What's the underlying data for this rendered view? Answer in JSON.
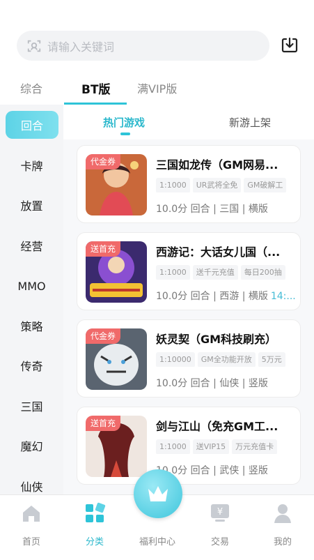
{
  "search": {
    "placeholder": "请输入关键词"
  },
  "main_tabs": [
    {
      "label": "综合"
    },
    {
      "label": "BT版"
    },
    {
      "label": "满VIP版"
    }
  ],
  "sidebar": {
    "items": [
      {
        "label": "回合"
      },
      {
        "label": "卡牌"
      },
      {
        "label": "放置"
      },
      {
        "label": "经营"
      },
      {
        "label": "MMO"
      },
      {
        "label": "策略"
      },
      {
        "label": "传奇"
      },
      {
        "label": "三国"
      },
      {
        "label": "魔幻"
      },
      {
        "label": "仙侠"
      }
    ]
  },
  "sub_tabs": [
    {
      "label": "热门游戏"
    },
    {
      "label": "新游上架"
    }
  ],
  "games": [
    {
      "badge": "代金券",
      "title": "三国如龙传（GM网易...",
      "tags": [
        "1:1000",
        "UR武将全免",
        "GM破解工"
      ],
      "meta": "10.0分 回合 | 三国 | 横版",
      "time": ""
    },
    {
      "badge": "送首充",
      "title": "西游记：大话女儿国（...",
      "tags": [
        "1:1000",
        "送千元充值",
        "每日200抽"
      ],
      "meta": "10.0分 回合 | 西游 | 横版",
      "time": "14:..."
    },
    {
      "badge": "代金券",
      "title": "妖灵契（GM科技刷充）",
      "tags": [
        "1:10000",
        "GM全功能开放",
        "5万元"
      ],
      "meta": "10.0分 回合 | 仙侠 | 竖版",
      "time": ""
    },
    {
      "badge": "送首充",
      "title": "剑与江山（免充GM工...",
      "tags": [
        "1:1000",
        "送VIP15",
        "万元充值卡"
      ],
      "meta": "10.0分 回合 | 武侠 | 竖版",
      "time": ""
    }
  ],
  "bottom_nav": [
    {
      "label": "首页",
      "icon": "home-icon"
    },
    {
      "label": "分类",
      "icon": "category-icon"
    },
    {
      "label": "福利中心",
      "icon": "crown-icon"
    },
    {
      "label": "交易",
      "icon": "trade-icon"
    },
    {
      "label": "我的",
      "icon": "user-icon"
    }
  ],
  "colors": {
    "accent": "#2ec4d8",
    "badge": "#f06a6a",
    "sidebar_bg": "#f4f5f7"
  }
}
